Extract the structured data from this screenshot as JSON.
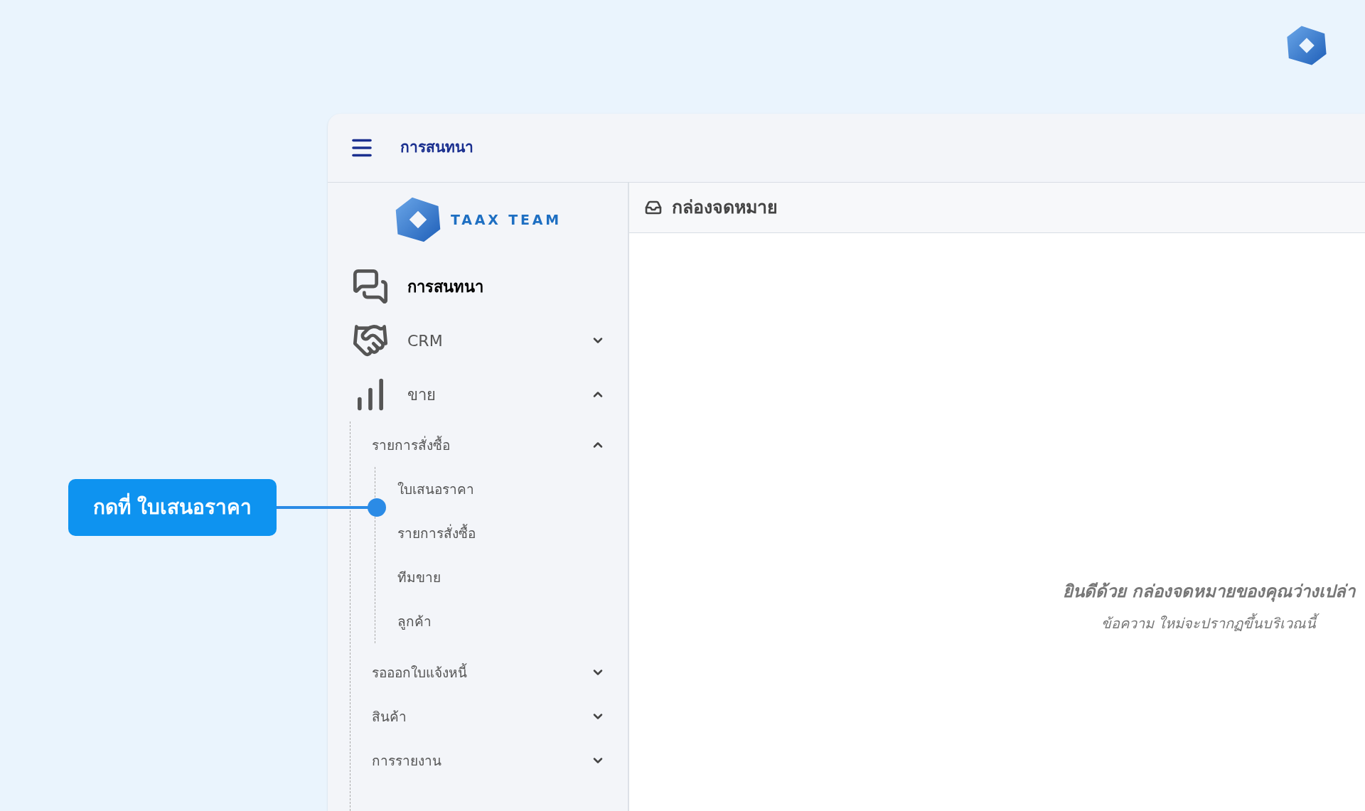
{
  "header": {
    "title": "การสนทนา"
  },
  "brand": {
    "name": "TAAX TEAM"
  },
  "nav": [
    {
      "label": "การสนทนา",
      "kind": "chat",
      "selected": true
    },
    {
      "label": "CRM",
      "kind": "crm",
      "selected": false,
      "expanded": false
    },
    {
      "label": "ขาย",
      "kind": "sales",
      "selected": false,
      "expanded": true,
      "children": [
        {
          "label": "รายการสั่งซื้อ",
          "expanded": true,
          "children": [
            {
              "label": "ใบเสนอราคา"
            },
            {
              "label": "รายการสั่งซื้อ"
            },
            {
              "label": "ทีมขาย"
            },
            {
              "label": "ลูกค้า"
            }
          ]
        },
        {
          "label": "รอออกใบแจ้งหนี้",
          "expanded": false
        },
        {
          "label": "สินค้า",
          "expanded": false
        },
        {
          "label": "การรายงาน",
          "expanded": false
        }
      ]
    }
  ],
  "inbox": {
    "title": "กล่องจดหมาย",
    "empty_title": "ยินดีด้วย กล่องจดหมายของคุณว่างเปล่า",
    "empty_subtitle": "ข้อความ ใหม่จะปรากฏขึ้นบริเวณนี้"
  },
  "callout": {
    "text": "กดที่ ใบเสนอราคา"
  }
}
